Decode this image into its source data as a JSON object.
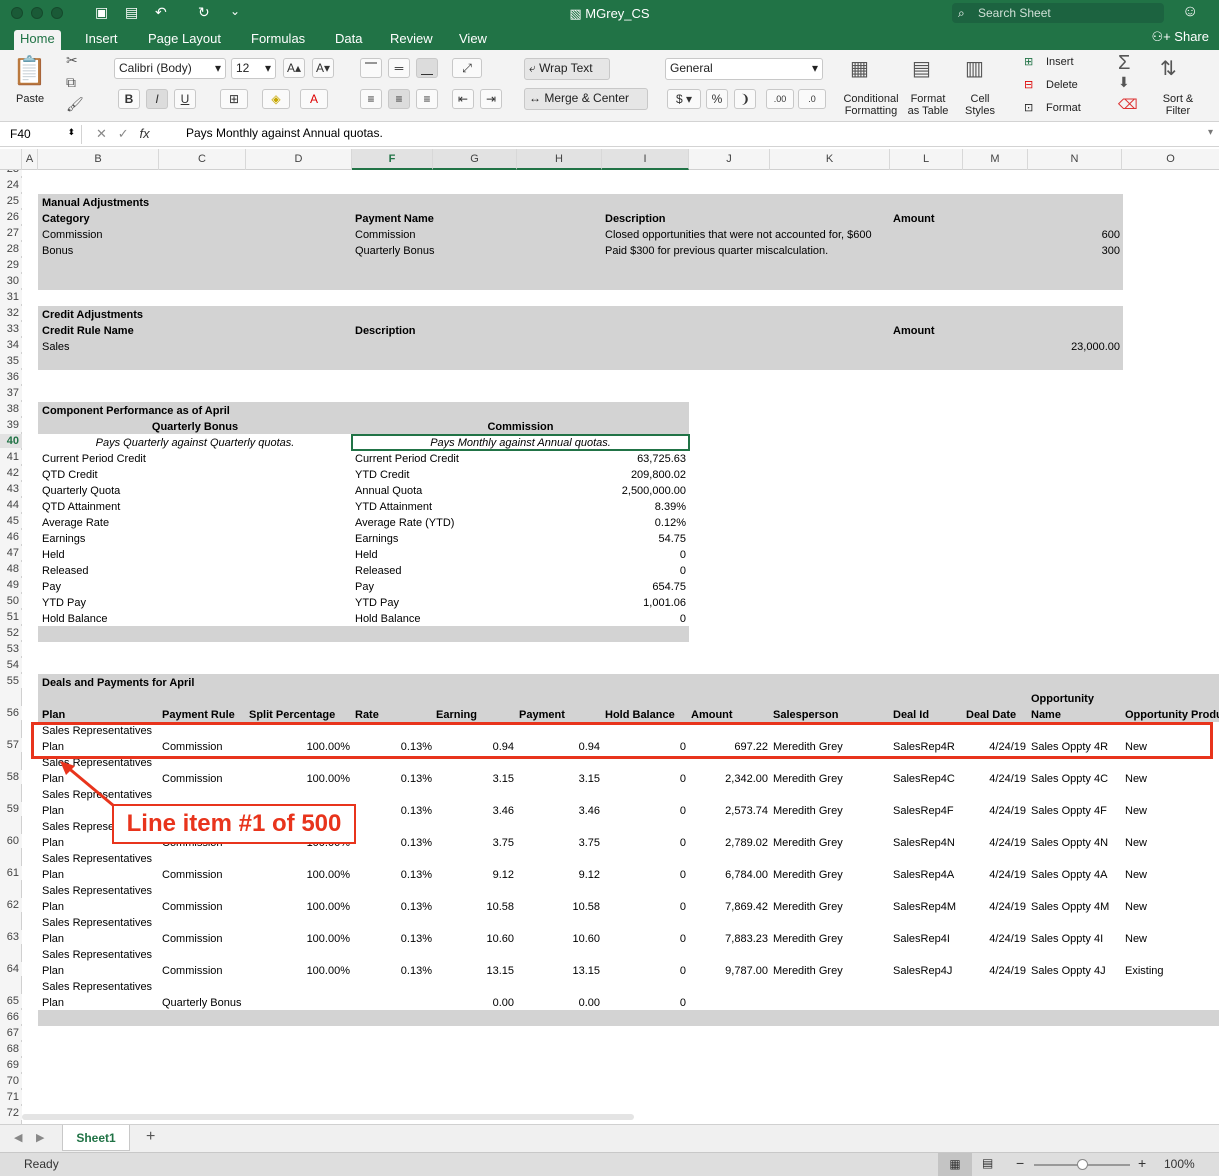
{
  "window": {
    "title": "MGrey_CS",
    "search_placeholder": "Search Sheet",
    "share_label": "Share"
  },
  "ribbon": {
    "tabs": [
      "Home",
      "Insert",
      "Page Layout",
      "Formulas",
      "Data",
      "Review",
      "View"
    ],
    "active_tab": "Home",
    "paste_label": "Paste",
    "font_name": "Calibri (Body)",
    "font_size": "12",
    "wrap_text": "Wrap Text",
    "merge_center": "Merge & Center",
    "number_format": "General",
    "conditional_formatting": "Conditional\nFormatting",
    "format_as_table": "Format\nas Table",
    "cell_styles": "Cell\nStyles",
    "insert": "Insert",
    "delete": "Delete",
    "format": "Format",
    "sort_filter": "Sort &\nFilter"
  },
  "formula_bar": {
    "name_box": "F40",
    "fx": "fx",
    "content": "Pays Monthly against Annual quotas."
  },
  "columns": [
    "A",
    "B",
    "C",
    "D",
    "F",
    "G",
    "H",
    "I",
    "J",
    "K",
    "L",
    "M",
    "N",
    "O"
  ],
  "selected_column": "F",
  "rows": [
    "23",
    "24",
    "25",
    "26",
    "27",
    "28",
    "29",
    "30",
    "31",
    "32",
    "33",
    "34",
    "35",
    "36",
    "37",
    "38",
    "39",
    "40",
    "41",
    "42",
    "43",
    "44",
    "45",
    "46",
    "47",
    "48",
    "49",
    "50",
    "51",
    "52",
    "53",
    "54",
    "55",
    "56",
    "57",
    "58",
    "59",
    "60",
    "61",
    "62",
    "63",
    "64",
    "65",
    "66",
    "67",
    "68",
    "69",
    "70",
    "71",
    "72"
  ],
  "selected_row": "40",
  "manual_adjustments": {
    "title": "Manual Adjustments",
    "headers": {
      "category": "Category",
      "payment_name": "Payment Name",
      "description": "Description",
      "amount": "Amount"
    },
    "rows": [
      {
        "category": "Commission",
        "payment_name": "Commission",
        "description": "Closed opportunities that were not accounted for, $600",
        "amount": "600"
      },
      {
        "category": "Bonus",
        "payment_name": "Quarterly Bonus",
        "description": "Paid $300 for previous quarter miscalculation.",
        "amount": "300"
      }
    ]
  },
  "credit_adjustments": {
    "title": "Credit Adjustments",
    "headers": {
      "rule": "Credit Rule Name",
      "description": "Description",
      "amount": "Amount"
    },
    "rows": [
      {
        "rule": "Sales",
        "amount": "23,000.00"
      }
    ]
  },
  "component_performance": {
    "title": "Component Performance as of April",
    "left_title": "Quarterly Bonus",
    "left_note": "Pays Quarterly against Quarterly quotas.",
    "right_title": "Commission",
    "right_note": "Pays Monthly against Annual quotas.",
    "left_labels": [
      "Current Period Credit",
      "QTD Credit",
      "Quarterly Quota",
      "QTD Attainment",
      "Average Rate",
      "Earnings",
      "Held",
      "Released",
      "Pay",
      "YTD Pay",
      "Hold Balance"
    ],
    "right_labels": [
      "Current Period Credit",
      "YTD Credit",
      "Annual Quota",
      "YTD Attainment",
      "Average Rate (YTD)",
      "Earnings",
      "Held",
      "Released",
      "Pay",
      "YTD Pay",
      "Hold Balance"
    ],
    "right_values": [
      "63,725.63",
      "209,800.02",
      "2,500,000.00",
      "8.39%",
      "0.12%",
      "54.75",
      "0",
      "0",
      "654.75",
      "1,001.06",
      "0"
    ]
  },
  "deals": {
    "title": "Deals and Payments for April",
    "headers": {
      "plan": "Plan",
      "payment_rule": "Payment Rule",
      "split": "Split Percentage",
      "rate": "Rate",
      "earning": "Earning",
      "payment": "Payment",
      "hold": "Hold Balance",
      "amount": "Amount",
      "salesperson": "Salesperson",
      "deal_id": "Deal Id",
      "deal_date": "Deal Date",
      "opp_name_1": "Opportunity",
      "opp_name_2": "Name",
      "opp_product": "Opportunity Produ"
    },
    "plan_line1": "Sales Representatives",
    "plan_line2": "Plan",
    "rows": [
      {
        "rule": "Commission",
        "split": "100.00%",
        "rate": "0.13%",
        "earning": "0.94",
        "payment": "0.94",
        "hold": "0",
        "amount": "697.22",
        "sp": "Meredith Grey",
        "deal": "SalesRep4R",
        "date": "4/24/19",
        "opp": "Sales Oppty 4R",
        "prod": "New"
      },
      {
        "rule": "Commission",
        "split": "100.00%",
        "rate": "0.13%",
        "earning": "3.15",
        "payment": "3.15",
        "hold": "0",
        "amount": "2,342.00",
        "sp": "Meredith Grey",
        "deal": "SalesRep4C",
        "date": "4/24/19",
        "opp": "Sales Oppty 4C",
        "prod": "New"
      },
      {
        "rule": "Commission",
        "split": "100.00%",
        "rate": "0.13%",
        "earning": "3.46",
        "payment": "3.46",
        "hold": "0",
        "amount": "2,573.74",
        "sp": "Meredith Grey",
        "deal": "SalesRep4F",
        "date": "4/24/19",
        "opp": "Sales Oppty 4F",
        "prod": "New"
      },
      {
        "rule": "Commission",
        "split": "100.00%",
        "rate": "0.13%",
        "earning": "3.75",
        "payment": "3.75",
        "hold": "0",
        "amount": "2,789.02",
        "sp": "Meredith Grey",
        "deal": "SalesRep4N",
        "date": "4/24/19",
        "opp": "Sales Oppty 4N",
        "prod": "New"
      },
      {
        "rule": "Commission",
        "split": "100.00%",
        "rate": "0.13%",
        "earning": "9.12",
        "payment": "9.12",
        "hold": "0",
        "amount": "6,784.00",
        "sp": "Meredith Grey",
        "deal": "SalesRep4A",
        "date": "4/24/19",
        "opp": "Sales Oppty 4A",
        "prod": "New"
      },
      {
        "rule": "Commission",
        "split": "100.00%",
        "rate": "0.13%",
        "earning": "10.58",
        "payment": "10.58",
        "hold": "0",
        "amount": "7,869.42",
        "sp": "Meredith Grey",
        "deal": "SalesRep4M",
        "date": "4/24/19",
        "opp": "Sales Oppty 4M",
        "prod": "New"
      },
      {
        "rule": "Commission",
        "split": "100.00%",
        "rate": "0.13%",
        "earning": "10.60",
        "payment": "10.60",
        "hold": "0",
        "amount": "7,883.23",
        "sp": "Meredith Grey",
        "deal": "SalesRep4I",
        "date": "4/24/19",
        "opp": "Sales Oppty 4I",
        "prod": "New"
      },
      {
        "rule": "Commission",
        "split": "100.00%",
        "rate": "0.13%",
        "earning": "13.15",
        "payment": "13.15",
        "hold": "0",
        "amount": "9,787.00",
        "sp": "Meredith Grey",
        "deal": "SalesRep4J",
        "date": "4/24/19",
        "opp": "Sales Oppty 4J",
        "prod": "Existing"
      },
      {
        "rule": "Quarterly Bonus",
        "split": "",
        "rate": "",
        "earning": "0.00",
        "payment": "0.00",
        "hold": "0",
        "amount": "",
        "sp": "",
        "deal": "",
        "date": "",
        "opp": "",
        "prod": ""
      }
    ]
  },
  "annotation": {
    "label": "Line item #1 of 500",
    "color": "#e8341c"
  },
  "sheet_tab": "Sheet1",
  "status": {
    "text": "Ready",
    "zoom": "100%"
  },
  "colors": {
    "accent": "#217346",
    "band": "#d3d3d3"
  }
}
